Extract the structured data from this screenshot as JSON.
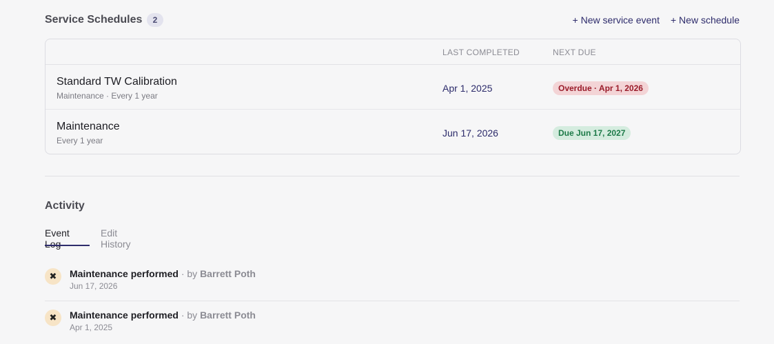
{
  "schedules": {
    "title": "Service Schedules",
    "count": "2",
    "actions": {
      "new_event": "+ New service event",
      "new_schedule": "+ New schedule"
    },
    "columns": {
      "last_completed": "LAST COMPLETED",
      "next_due": "NEXT DUE"
    },
    "rows": [
      {
        "name": "Standard TW Calibration",
        "sub": "Maintenance · Every 1 year",
        "last_completed": "Apr 1, 2025",
        "next_due": "Overdue · Apr 1, 2026",
        "status": "overdue"
      },
      {
        "name": "Maintenance",
        "sub": "Every 1 year",
        "last_completed": "Jun 17, 2026",
        "next_due": "Due Jun 17, 2027",
        "status": "ok"
      }
    ]
  },
  "activity": {
    "title": "Activity",
    "tabs": [
      {
        "label": "Event Log",
        "active": true
      },
      {
        "label": "Edit History",
        "active": false
      }
    ],
    "events": [
      {
        "action": "Maintenance performed",
        "by": " · by ",
        "user": "Barrett Poth",
        "date": "Jun 17, 2026",
        "icon": "tools-icon"
      },
      {
        "action": "Maintenance performed",
        "by": " · by ",
        "user": "Barrett Poth",
        "date": "Apr 1, 2025",
        "icon": "tools-icon"
      }
    ]
  },
  "colors": {
    "accent": "#2d2b6b",
    "overdue_bg": "#f3d4d6",
    "overdue_fg": "#9a1c2a",
    "ok_bg": "#d5ecdf",
    "ok_fg": "#1d7a48"
  }
}
